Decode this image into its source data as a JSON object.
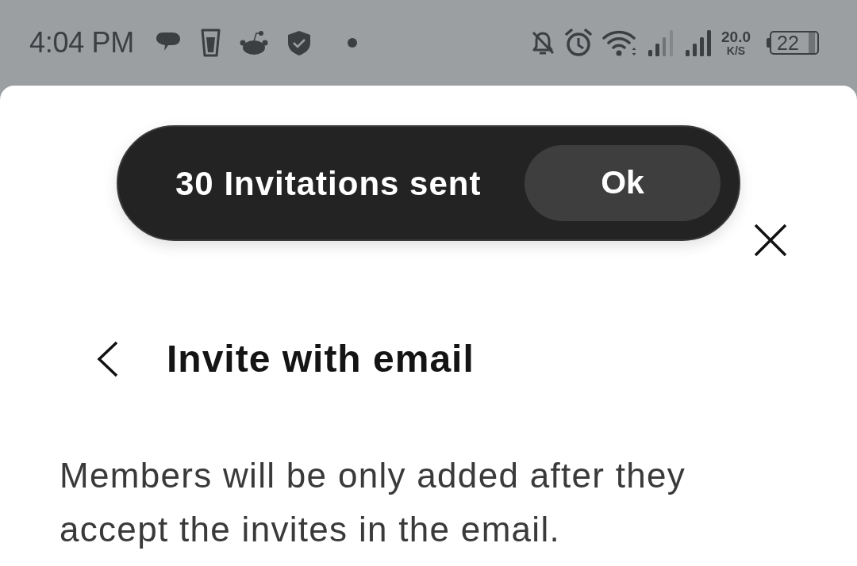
{
  "status_bar": {
    "time": "4:04 PM",
    "speed": "20.0",
    "speed_unit": "K/S",
    "battery": "22"
  },
  "toast": {
    "message": "30 Invitations sent",
    "button": "Ok"
  },
  "sheet": {
    "title": "Invite with email",
    "description": "Members will be only added after they accept the invites in the email."
  }
}
